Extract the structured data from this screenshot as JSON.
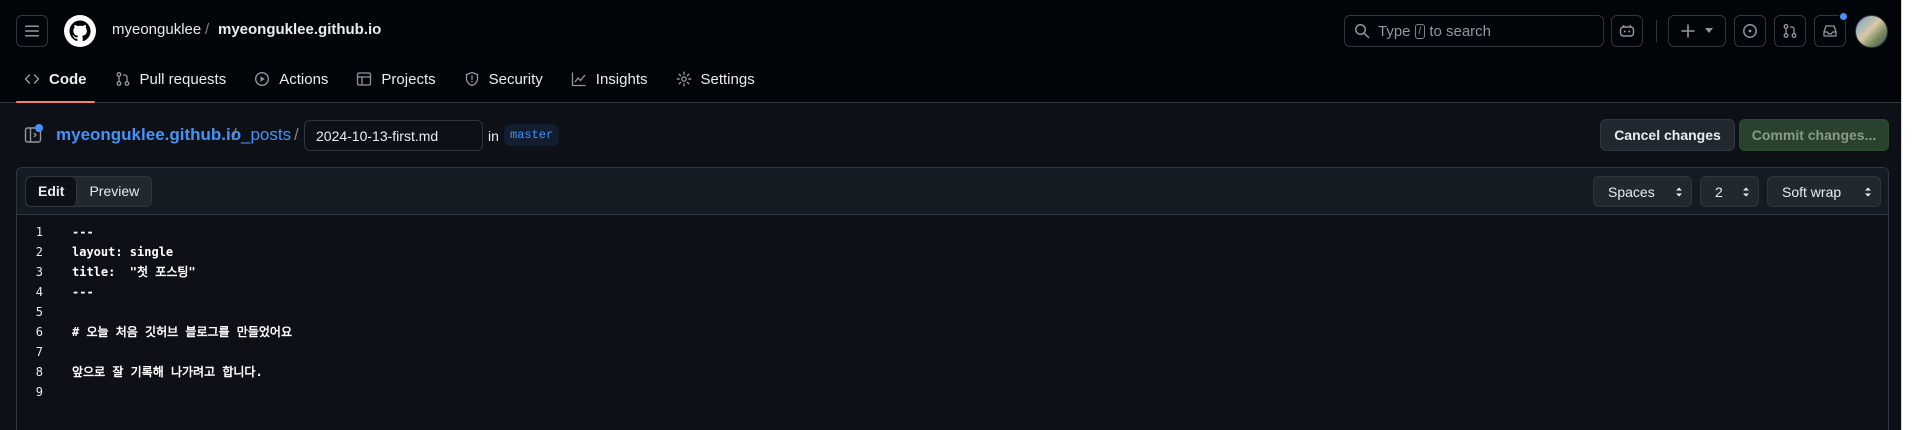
{
  "header": {
    "owner": "myeonguklee",
    "separator": "/",
    "repo": "myeonguklee.github.io",
    "search": {
      "prefix": "Type",
      "key": "/",
      "suffix": "to search"
    }
  },
  "tabs": [
    {
      "label": "Code",
      "icon": "code-icon"
    },
    {
      "label": "Pull requests",
      "icon": "pull-request-icon"
    },
    {
      "label": "Actions",
      "icon": "play-icon"
    },
    {
      "label": "Projects",
      "icon": "table-icon"
    },
    {
      "label": "Security",
      "icon": "shield-icon"
    },
    {
      "label": "Insights",
      "icon": "graph-icon"
    },
    {
      "label": "Settings",
      "icon": "gear-icon"
    }
  ],
  "file": {
    "repo": "myeonguklee.github.io",
    "sep1": "/",
    "dir": "_posts",
    "sep2": "/",
    "filename": "2024-10-13-first.md",
    "in_label": "in",
    "branch": "master"
  },
  "actions": {
    "cancel": "Cancel changes",
    "commit": "Commit changes..."
  },
  "editor": {
    "mode_edit": "Edit",
    "mode_preview": "Preview",
    "indent_mode": "Spaces",
    "indent_size": "2",
    "wrap_mode": "Soft wrap",
    "lines": [
      {
        "n": "1",
        "text": "---"
      },
      {
        "n": "2",
        "text": "layout: single"
      },
      {
        "n": "3",
        "text": "title:  \"첫 포스팅\""
      },
      {
        "n": "4",
        "text": "---"
      },
      {
        "n": "5",
        "text": ""
      },
      {
        "n": "6",
        "text": "# 오늘 처음 깃허브 블로그를 만들었어요"
      },
      {
        "n": "7",
        "text": ""
      },
      {
        "n": "8",
        "text": "앞으로 잘 기록해 나가려고 합니다."
      },
      {
        "n": "9",
        "text": ""
      }
    ]
  },
  "colors": {
    "accent_link": "#4493f8",
    "tab_underline": "#f78166",
    "commit_bg": "#29412d"
  }
}
